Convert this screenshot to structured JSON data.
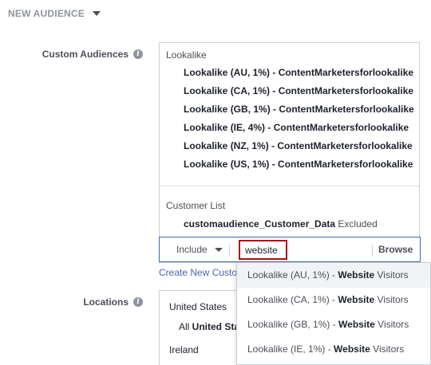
{
  "header": {
    "title": "NEW AUDIENCE"
  },
  "custom_audiences": {
    "label": "Custom Audiences",
    "lookalike_title": "Lookalike",
    "lookalikes": [
      "Lookalike (AU, 1%) - ContentMarketersforlookalike",
      "Lookalike (CA, 1%) - ContentMarketersforlookalike",
      "Lookalike (GB, 1%) - ContentMarketersforlookalike",
      "Lookalike (IE, 4%) - ContentMarketersforlookalike",
      "Lookalike (NZ, 1%) - ContentMarketersforlookalike",
      "Lookalike (US, 1%) - ContentMarketersforlookalike"
    ],
    "customer_list_title": "Customer List",
    "customer_list_name": "customaudience_Customer_Data",
    "customer_list_status": "Excluded",
    "include_label": "Include",
    "search_value": "website",
    "browse_label": "Browse",
    "create_link": "Create New Custo"
  },
  "suggestions": [
    {
      "prefix": "Lookalike (AU, 1%) - ",
      "bold": "Website",
      "suffix": " Visitors"
    },
    {
      "prefix": "Lookalike (CA, 1%) - ",
      "bold": "Website",
      "suffix": " Visitors"
    },
    {
      "prefix": "Lookalike (GB, 1%) - ",
      "bold": "Website",
      "suffix": " Visitors"
    },
    {
      "prefix": "Lookalike (IE, 1%) - ",
      "bold": "Website",
      "suffix": " Visitors"
    }
  ],
  "locations": {
    "label": "Locations",
    "country_1": "United States",
    "sub_prefix": "All ",
    "sub_bold": "United Sta",
    "country_2": "Ireland"
  },
  "icons": {
    "info": "info-icon",
    "caret": "caret-down-icon"
  },
  "colors": {
    "accent": "#4267b2",
    "highlight_border": "#a90f16",
    "hover_bg": "#f2f3f5"
  }
}
